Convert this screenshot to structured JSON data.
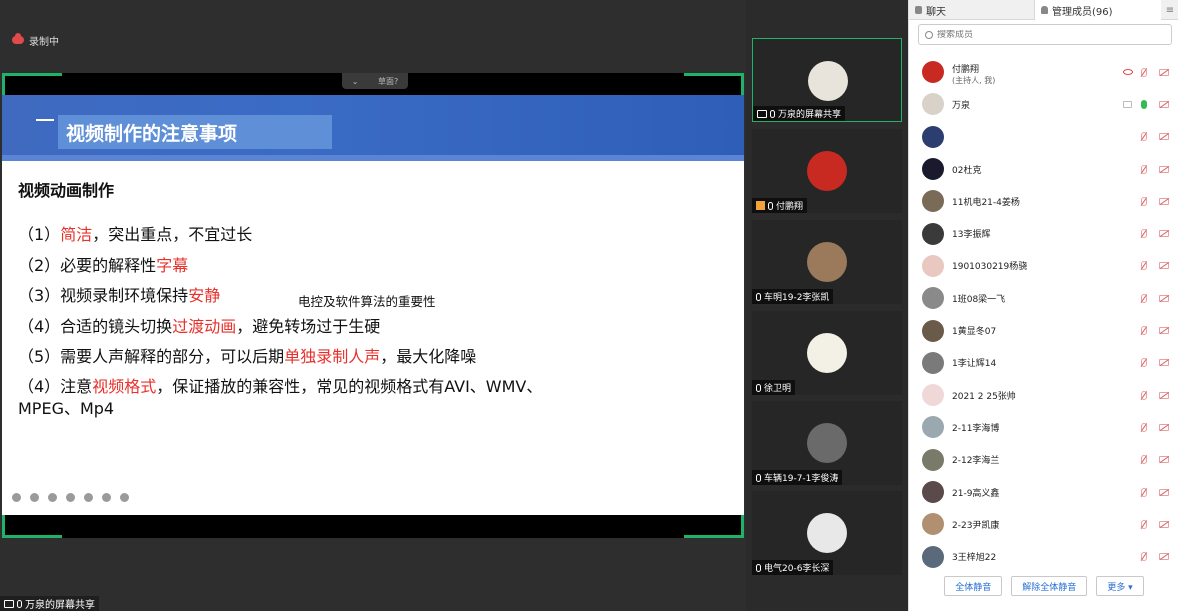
{
  "recording": {
    "label": "录制中"
  },
  "share_bar": {
    "chevron": "⌄",
    "text": "草面?"
  },
  "slide": {
    "title": "视频制作的注意事项",
    "subtitle": "视频动画制作",
    "note": "电控及软件算法的重要性",
    "lines": [
      {
        "pre": "（1）",
        "hl": "简洁",
        "post": "，突出重点，不宜过长"
      },
      {
        "pre": "（2）必要的解释性",
        "hl": "字幕",
        "post": ""
      },
      {
        "pre": "（3）视频录制环境保持",
        "hl": "安静",
        "post": ""
      },
      {
        "pre": "（4）合适的镜头切换",
        "hl": "过渡动画",
        "post": "，避免转场过于生硬"
      },
      {
        "pre": "（5）需要人声解释的部分，可以后期",
        "hl": "单独录制人声",
        "post": "，最大化降噪"
      },
      {
        "pre": "（4）注意",
        "hl": "视频格式",
        "post": "，保证播放的兼容性，常见的视频格式有AVI、WMV、"
      }
    ],
    "line7": "MPEG、Mp4"
  },
  "share_label": "万泉的屏幕共享",
  "videos": [
    {
      "name": "万泉的屏幕共享",
      "color": "#e8e4dc"
    },
    {
      "name": "付鹏翔",
      "color": "#c82a22"
    },
    {
      "name": "车明19-2李张凯",
      "color": "#9a7a5a"
    },
    {
      "name": "徐卫明",
      "color": "#f3f0e6"
    },
    {
      "name": "车辆19-7-1李俊涛",
      "color": "#6a6a6a"
    },
    {
      "name": "电气20-6李长深",
      "color": "#e8e8e8"
    }
  ],
  "panel": {
    "tab_chat": "聊天",
    "tab_members": "管理成员(96)",
    "tab_menu": "≡",
    "search_placeholder": "搜索成员",
    "members": [
      {
        "name": "付鹏翔",
        "sub": "(主持人, 我)",
        "color": "#c82a22",
        "eye": true
      },
      {
        "name": "万泉",
        "sub": "",
        "color": "#d8d2c8",
        "mic_on": true,
        "screen": true
      },
      {
        "name": "",
        "sub": "",
        "color": "#2c3e70"
      },
      {
        "name": "02杜克",
        "sub": "",
        "color": "#1a1a2e"
      },
      {
        "name": "11机电21-4姜杨",
        "sub": "",
        "color": "#7a6a58"
      },
      {
        "name": "13李振辉",
        "sub": "",
        "color": "#3a3a3a"
      },
      {
        "name": "1901030219杨骁",
        "sub": "",
        "color": "#e8c8c0"
      },
      {
        "name": "1班08梁一飞",
        "sub": "",
        "color": "#8a8a8a"
      },
      {
        "name": "1黄显冬07",
        "sub": "",
        "color": "#6a5a4a"
      },
      {
        "name": "1李让辉14",
        "sub": "",
        "color": "#7a7a7a"
      },
      {
        "name": "2021 2 25张帅",
        "sub": "",
        "color": "#f0d8d8"
      },
      {
        "name": "2-11李海博",
        "sub": "",
        "color": "#9aa8b0"
      },
      {
        "name": "2-12李海兰",
        "sub": "",
        "color": "#7a7a6a"
      },
      {
        "name": "21-9高义鑫",
        "sub": "",
        "color": "#5a4a4a"
      },
      {
        "name": "2-23尹凯康",
        "sub": "",
        "color": "#b09070"
      },
      {
        "name": "3王梓旭22",
        "sub": "",
        "color": "#5a6a7a"
      }
    ],
    "footer": {
      "mute_all": "全体静音",
      "unmute_all": "解除全体静音",
      "more": "更多 ▾"
    }
  }
}
